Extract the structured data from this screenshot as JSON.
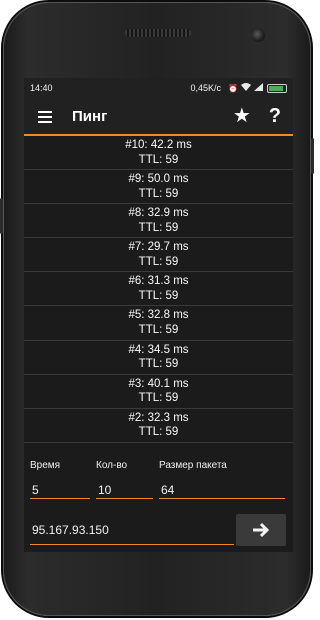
{
  "status_bar": {
    "time": "14:40",
    "network_speed": "0,45K/c",
    "icons": [
      "alarm-icon",
      "wifi-icon",
      "signal-icon",
      "battery-icon"
    ],
    "battery_level": 0.9,
    "battery_color": "#4caf50"
  },
  "app_bar": {
    "title": "Пинг",
    "icons": [
      "menu-icon",
      "star-icon",
      "help-icon"
    ],
    "help_glyph": "?",
    "accent_color": "#ef8a2a"
  },
  "results": [
    {
      "line1": "#10: 42.2 ms",
      "line2": "TTL: 59"
    },
    {
      "line1": "#9: 50.0 ms",
      "line2": "TTL: 59"
    },
    {
      "line1": "#8: 32.9 ms",
      "line2": "TTL: 59"
    },
    {
      "line1": "#7: 29.7 ms",
      "line2": "TTL: 59"
    },
    {
      "line1": "#6: 31.3 ms",
      "line2": "TTL: 59"
    },
    {
      "line1": "#5: 32.8 ms",
      "line2": "TTL: 59"
    },
    {
      "line1": "#4: 34.5 ms",
      "line2": "TTL: 59"
    },
    {
      "line1": "#3: 40.1 ms",
      "line2": "TTL: 59"
    },
    {
      "line1": "#2: 32.3 ms",
      "line2": "TTL: 59"
    }
  ],
  "params": {
    "time_label": "Время",
    "time_value": "5",
    "count_label": "Кол-во",
    "count_value": "10",
    "size_label": "Размер пакета",
    "size_value": "64"
  },
  "host": {
    "value": "95.167.93.150",
    "go_icon": "arrow-right-icon"
  }
}
